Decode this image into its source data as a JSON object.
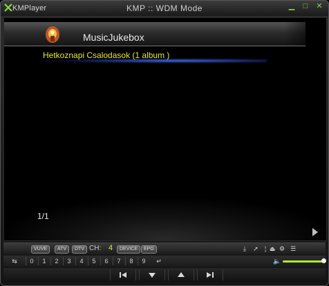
{
  "window": {
    "brand": "KMPlayer",
    "title": "KMP :: WDM Mode"
  },
  "screen": {
    "app_name": "MusicJukebox",
    "album_item": "Hetkoznapi Csalodasok (1 album )",
    "page_indicator": "1/1"
  },
  "tv_controls": {
    "buttons": [
      "VUVE",
      "ATV",
      "DTV"
    ],
    "channel_label": "CH:",
    "channel_value": "4",
    "device_label": "DEVICE",
    "epg_label": "EPG"
  },
  "number_keys": [
    "0",
    "1",
    "2",
    "3",
    "4",
    "5",
    "6",
    "7",
    "8",
    "9"
  ],
  "volume": {
    "level": 0.95,
    "accent_color": "#aeea2e"
  },
  "colors": {
    "album_text": "#e8e63a",
    "highlight": "#3c6cff"
  }
}
